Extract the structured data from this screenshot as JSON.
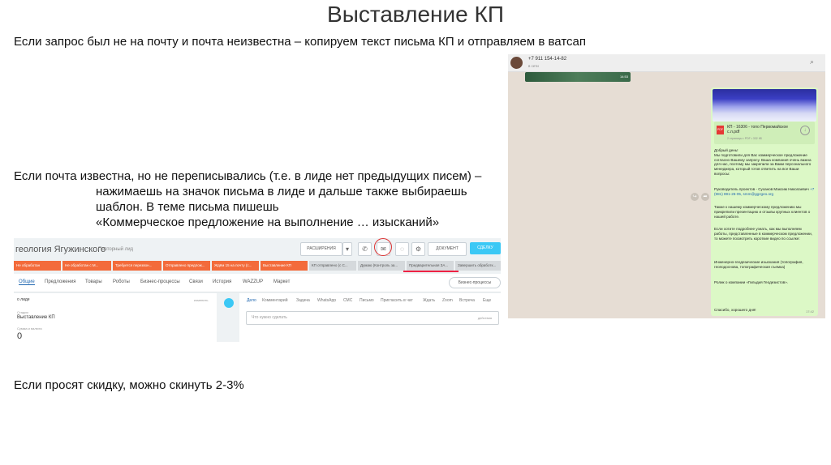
{
  "slide": {
    "title": "Выставление КП",
    "line1": "Если запрос был не на почту и почта неизвестна – копируем текст письма КП и отправляем в ватсап",
    "block2": [
      "Если почта известна, но не переписывались (т.е. в лиде нет предыдущих писем) –",
      "нажимаешь на значок письма в лиде и дальше также выбираешь",
      "шаблон. В теме письма пишешь",
      "«Коммерческое предложение на выполнение … изысканий»"
    ],
    "line3": "Если просят скидку, можно скинуть 2-3%"
  },
  "crm": {
    "title": "геология Ягужинского",
    "subtitle": "Повторный лид",
    "btn_extend": "РАСШИРЕНИЯ",
    "btn_document": "ДОКУМЕНТ",
    "btn_save": "СДЕЛКУ",
    "stages": [
      "Не обработан",
      "Не обработан с М...",
      "Требуется перезвон...",
      "Отправлено предлож...",
      "Ждём 15 на почту (с...",
      "Выставление КП",
      "КП отправлено (с С...",
      "Думаю (Контроль за...",
      "Предварительная ЗА...",
      "Завершить обработк..."
    ],
    "tabs": [
      "Общие",
      "Предложения",
      "Товары",
      "Роботы",
      "Бизнес-процессы",
      "Связи",
      "История",
      "WAZZUP",
      "Маркет"
    ],
    "bp_button": "Бизнес-процессы",
    "left": {
      "field_lid": "о лиде",
      "change": "изменить",
      "stage_label": "Стадия",
      "stage_value": "Выставление КП",
      "sum_label": "Сумма и валюта",
      "sum_value": "0"
    },
    "feed_tabs": [
      "Дело",
      "Комментарий",
      "Задача",
      "WhatsApp",
      "СМС",
      "Письмо",
      "Пригласить в чат",
      "Ждать",
      "Zoom",
      "Встреча",
      "Еще"
    ],
    "feed_placeholder": "Что нужно сделать",
    "feed_action": "действия"
  },
  "whatsapp": {
    "phone": "+7 911 154-14-82",
    "status": "в сети",
    "media_time": "14:53",
    "file_name": "КП - 16306 - топо Первомайское с.л.pdf",
    "file_meta": "2 страницы • PDF • 332 КБ",
    "message_paragraphs": [
      "Добрый день!\nМы подготовили для Вас коммерческое предложение согласно Вашему запросу. Ваша компания очень важна для нас, поэтому мы закрепили за Вами персонального менеджера, который готов ответить на все Ваши вопросы:",
      "Руководитель проектов - Суханов Максим Николаевич",
      "Также к нашему коммерческому предложению мы прикрепили презентацию и отзывы крупных клиентов о нашей работе.",
      "Если хотите подробнее узнать, как мы выполняем работы, представленные в коммерческом предложении, то можете посмотреть короткие видео по ссылке:",
      "Инженерно-геодезические изыскания (топография, геоподоснова, топографическая съемка)",
      "Ролик о компании «Гильдия Геодезистов».",
      "Спасибо, хорошего дня!"
    ],
    "contact_link": "+7 (981) 891-26-05, smm@ggzgeo.org",
    "msg_time": "17:42",
    "colors": {
      "bubble": "#dcf8c6",
      "background": "#e6ddd4",
      "header": "#eeeeee"
    }
  }
}
